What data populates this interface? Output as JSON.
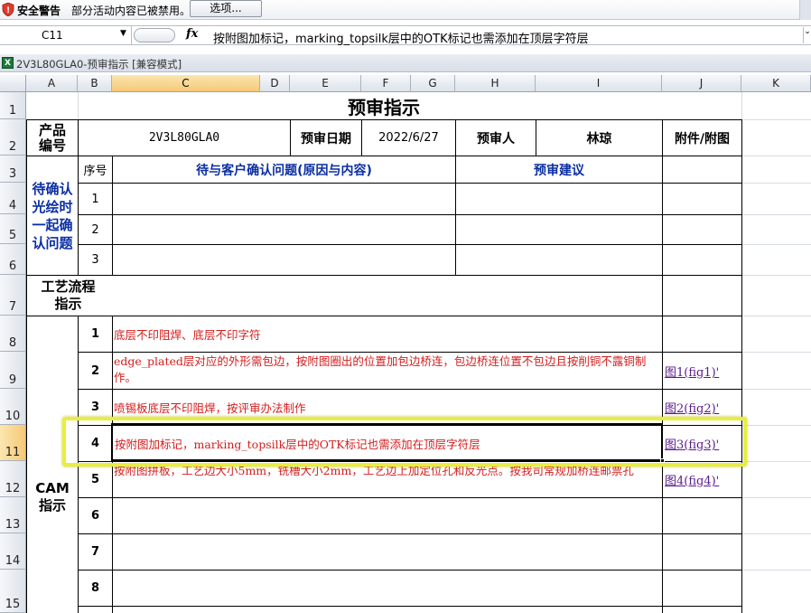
{
  "security_bar": {
    "title": "安全警告",
    "message": "部分活动内容已被禁用。",
    "options_button": "选项..."
  },
  "formula_bar": {
    "name_box": "C11",
    "fx": "fx",
    "content": "按附图加标记，marking_topsilk层中的OTK标记也需添加在顶层字符层"
  },
  "workbook": {
    "title": "2V3L80GLA0-预审指示  [兼容模式]"
  },
  "columns": [
    "A",
    "B",
    "C",
    "D",
    "E",
    "F",
    "G",
    "H",
    "I",
    "J",
    "K"
  ],
  "rows": [
    "1",
    "2",
    "3",
    "4",
    "5",
    "6",
    "7",
    "8",
    "9",
    "10",
    "11",
    "12",
    "13",
    "14",
    "15"
  ],
  "selected_cell": "C11",
  "sheet": {
    "title": "预审指示",
    "product_label": "产品\n编号",
    "product_value": "2V3L80GLA0",
    "review_date_label": "预审日期",
    "review_date_value": "2022/6/27",
    "reviewer_label": "预审人",
    "reviewer_value": "林琼",
    "attachment_label": "附件/附图",
    "seq_label": "序号",
    "confirm_question_label": "待与客户确认问题(原因与内容)",
    "review_suggestion_label": "预审建议",
    "confirm_section_label": "待确认\n光绘时\n一起确\n认问题",
    "confirm_rows": [
      "1",
      "2",
      "3"
    ],
    "process_label": "工艺流程\n指示",
    "cam_label": "CAM\n指示",
    "cam_rows": [
      {
        "no": "1",
        "text": "底层不印阻焊、底层不印字符",
        "link": ""
      },
      {
        "no": "2",
        "text": "edge_plated层对应的外形需包边，按附图圈出的位置加包边桥连，包边桥连位置不包边且按削铜不露铜制作。",
        "link": "图1(fig1)'"
      },
      {
        "no": "3",
        "text": "喷锡板底层不印阻焊，按评审办法制作",
        "link": "图2(fig2)'"
      },
      {
        "no": "4",
        "text": "按附图加标记，marking_topsilk层中的OTK标记也需添加在顶层字符层",
        "link": "图3(fig3)'"
      },
      {
        "no": "5",
        "text": "按附图拼板，工艺边大小5mm，铣槽大小2mm，工艺边上加定位孔和反光点。按我司常规加桥连邮票孔",
        "link": "图4(fig4)'"
      },
      {
        "no": "6",
        "text": "",
        "link": ""
      },
      {
        "no": "7",
        "text": "",
        "link": ""
      },
      {
        "no": "8",
        "text": "",
        "link": ""
      }
    ]
  },
  "colors": {
    "blue_text": "#0b2fa3",
    "red_text": "#d41d1d",
    "highlight": "#e9ee3c",
    "selected_header": "#f6c977"
  }
}
